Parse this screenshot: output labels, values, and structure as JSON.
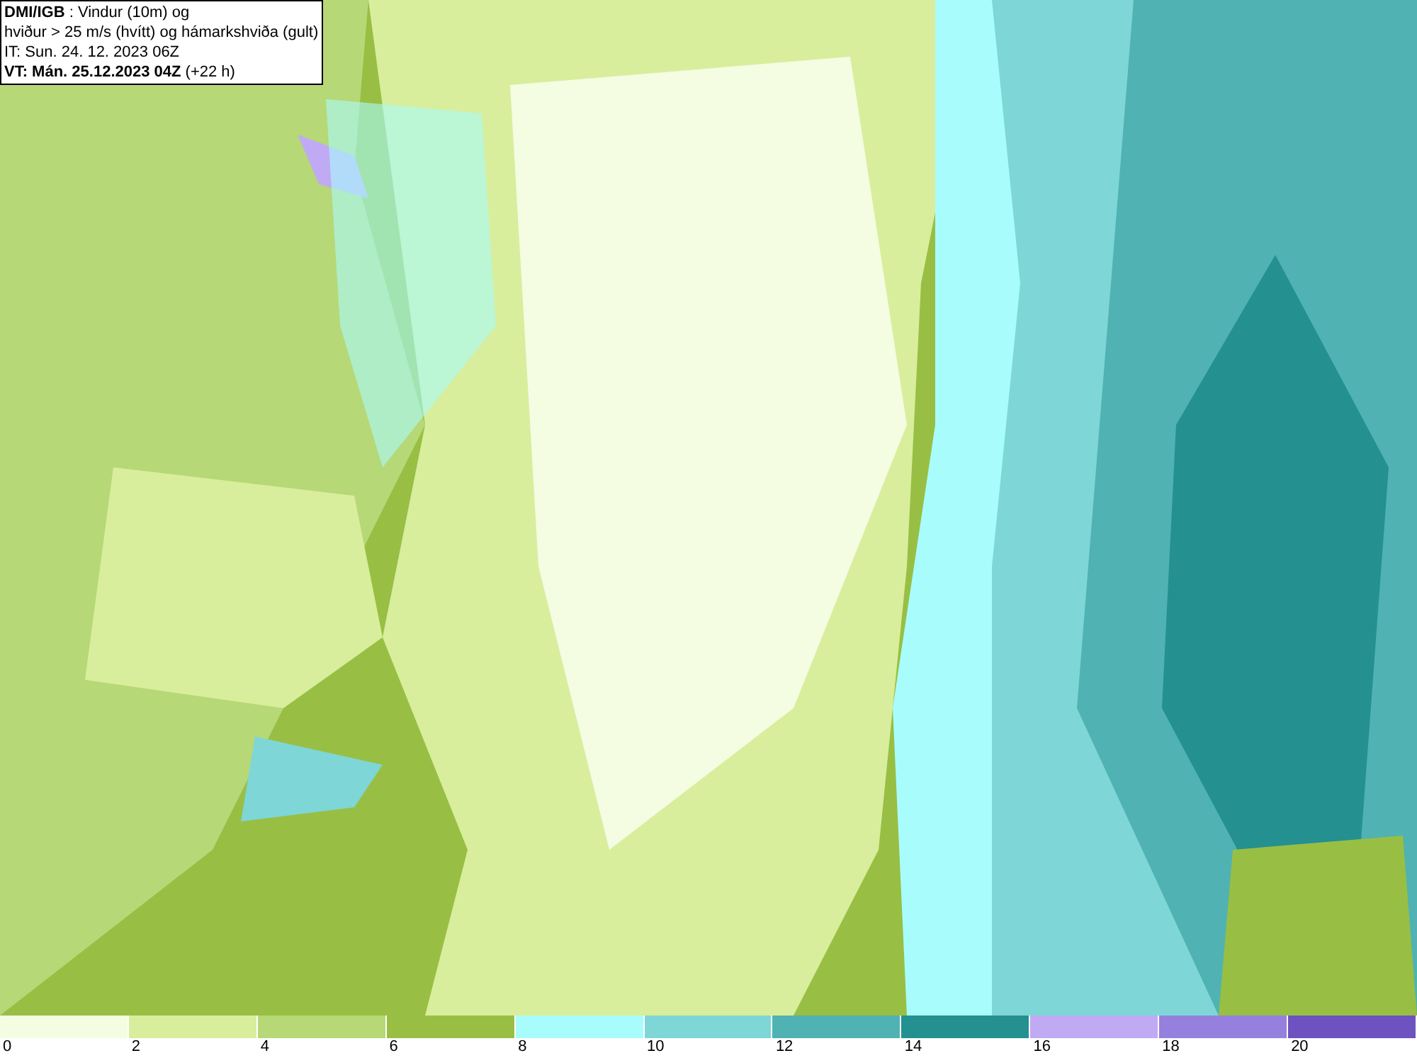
{
  "header": {
    "lines": [
      "**DMI/IGB** : Vindur (10m) og",
      "hviður > 25 m/s (hvítt) og hámarkshviða (gult)",
      "IT: Sun. 24. 12. 2023 06Z",
      "**VT: Mán. 25.12.2023 04Z** (+22 h)"
    ]
  },
  "legend": [
    {
      "label": "0",
      "color": "#f4fce2"
    },
    {
      "label": "2",
      "color": "#d8ee9c"
    },
    {
      "label": "4",
      "color": "#b6d876"
    },
    {
      "label": "6",
      "color": "#98bf44"
    },
    {
      "label": "8",
      "color": "#a9fcfc"
    },
    {
      "label": "10",
      "color": "#7ed6d6"
    },
    {
      "label": "12",
      "color": "#50b2b2"
    },
    {
      "label": "14",
      "color": "#249090"
    },
    {
      "label": "16",
      "color": "#c0aaf4"
    },
    {
      "label": "18",
      "color": "#9680de"
    },
    {
      "label": "20",
      "color": "#6e52c0"
    }
  ]
}
